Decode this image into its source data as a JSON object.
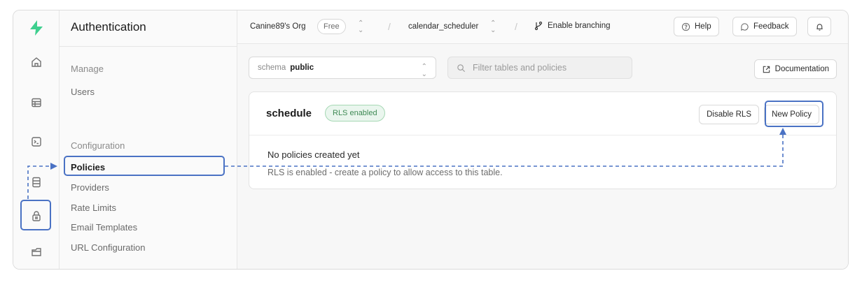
{
  "sidebar": {
    "title": "Authentication",
    "sections": [
      {
        "heading": "Manage",
        "items": [
          {
            "label": "Users",
            "active": false
          }
        ]
      },
      {
        "heading": "Configuration",
        "items": [
          {
            "label": "Policies",
            "active": true
          },
          {
            "label": "Providers",
            "active": false
          },
          {
            "label": "Rate Limits",
            "active": false
          },
          {
            "label": "Email Templates",
            "active": false
          },
          {
            "label": "URL Configuration",
            "active": false
          }
        ]
      }
    ]
  },
  "rail": {
    "icons": [
      "supabase-logo-icon",
      "home-icon",
      "table-editor-icon",
      "sql-editor-icon",
      "database-icon",
      "auth-lock-icon",
      "storage-icon"
    ],
    "active": "auth-lock-icon"
  },
  "topbar": {
    "org": "Canine89's Org",
    "plan": "Free",
    "project": "calendar_scheduler",
    "branching": "Enable branching",
    "help": "Help",
    "feedback": "Feedback"
  },
  "main": {
    "schema_label": "schema",
    "schema_value": "public",
    "filter_placeholder": "Filter tables and policies",
    "documentation": "Documentation",
    "table": {
      "name": "schedule",
      "rls_badge": "RLS enabled",
      "disable_rls": "Disable RLS",
      "new_policy": "New Policy",
      "empty_title": "No policies created yet",
      "empty_message": "RLS is enabled - create a policy to allow access to this table."
    }
  },
  "colors": {
    "accent_annotation": "#4a72c4",
    "rls_green": "#3f8a55",
    "brand_green": "#3ecf8e"
  }
}
